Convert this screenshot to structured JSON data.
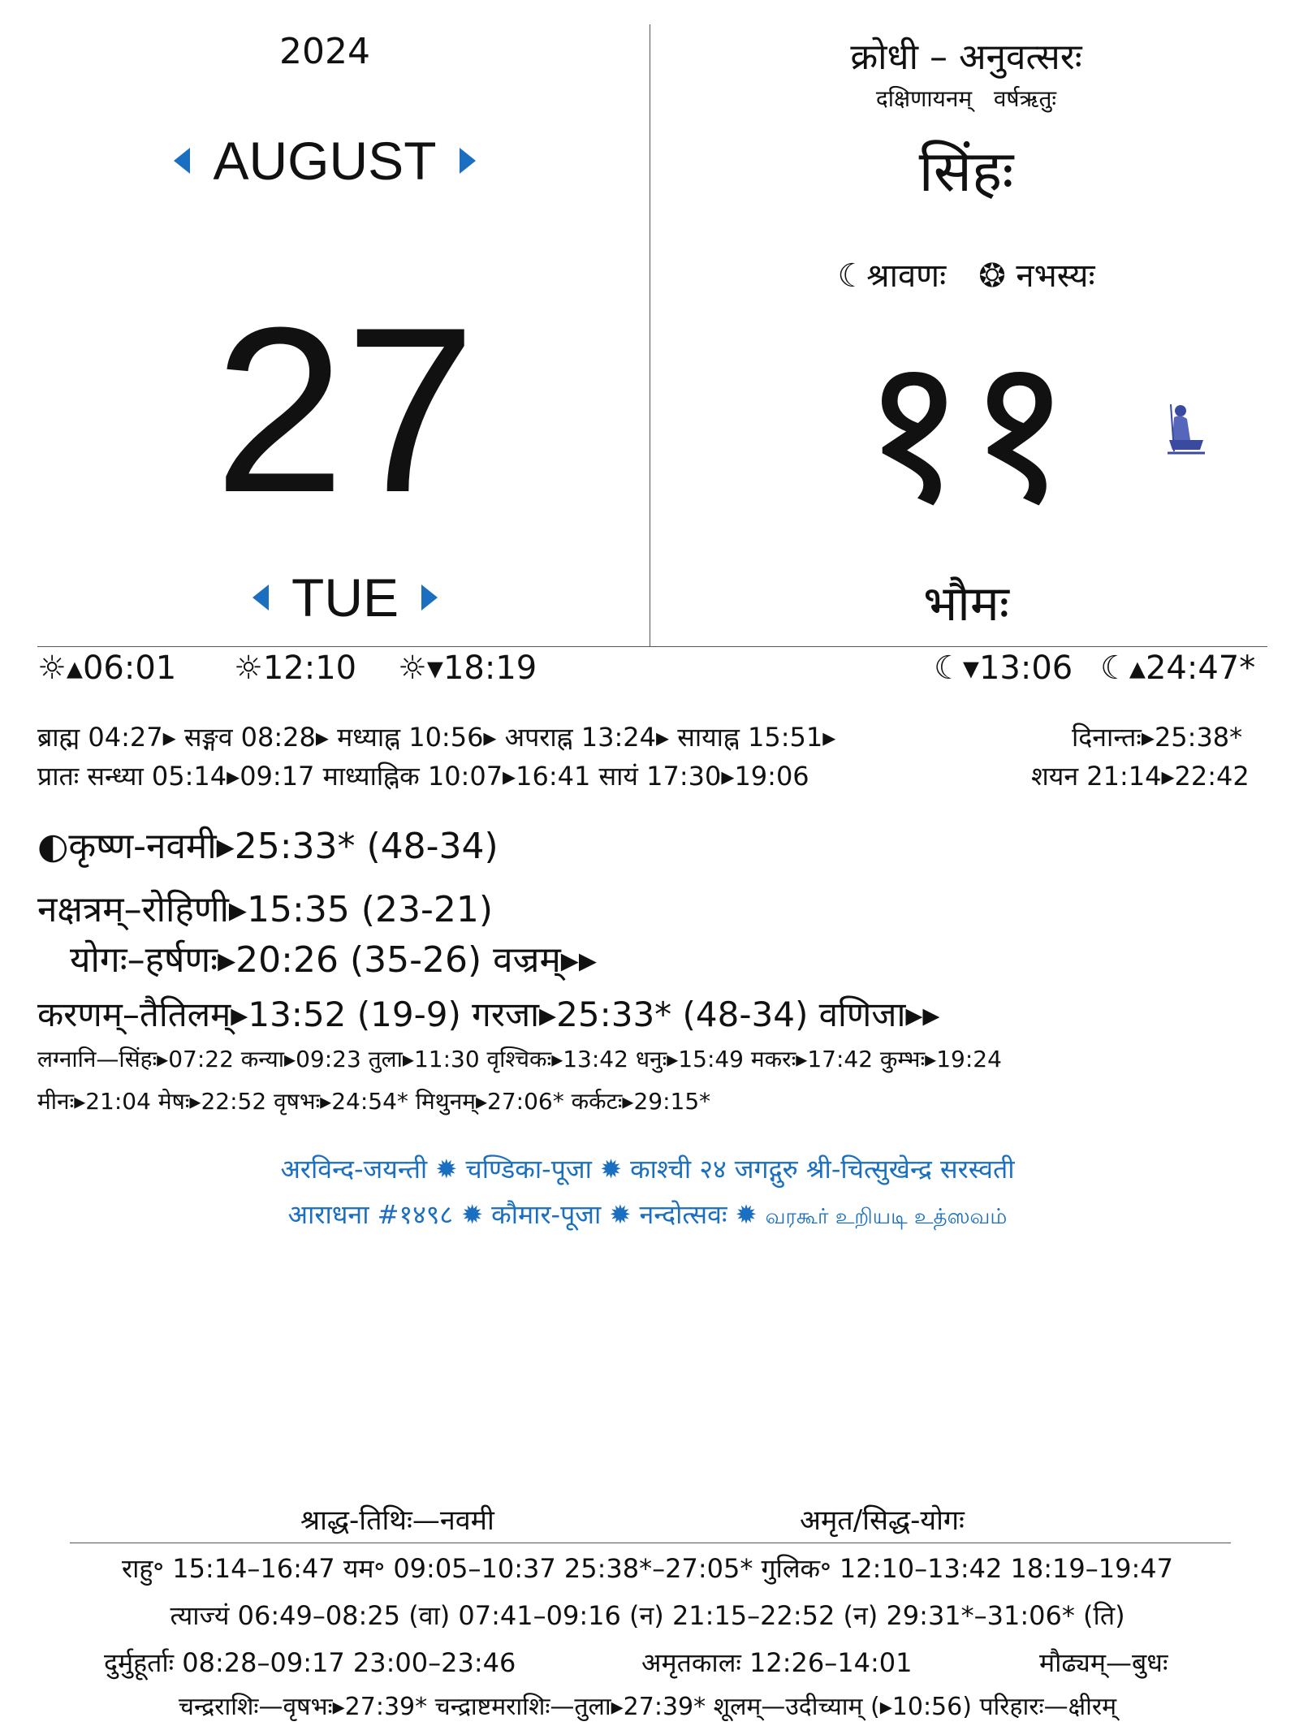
{
  "header": {
    "year": "2024",
    "month": "AUGUST",
    "day_number": "27",
    "weekday": "TUE",
    "samvatsara": "क्रोधी – अनुवत्सरः",
    "ayana_ritu": "दक्षिणायनम्   वर्षऋतुः",
    "rashi_month": "सिंहः",
    "lunar_month": "☾श्रावणः",
    "solar_month": "❂ नभस्यः",
    "tithi_number": "११",
    "vara": "भौमः"
  },
  "sun_moon": {
    "sunrise": "☼▴06:01",
    "noon": "☼12:10",
    "sunset": "☼▾18:19",
    "moonset": "☾▾13:06",
    "moonrise": "☾▴24:47*"
  },
  "kala": {
    "line1": "ब्राह्म 04:27▸ सङ्गव 08:28▸ मध्याह्न 10:56▸ अपराह्न 13:24▸ सायाह्न 15:51▸",
    "dinanta": "दिनान्तः▸25:38*",
    "line2": "प्रातः सन्ध्या 05:14▸09:17 माध्याह्निक 10:07▸16:41 सायं 17:30▸19:06",
    "shayana": "शयन 21:14▸22:42"
  },
  "panchanga": {
    "tithi": "◐कृष्ण-नवमी▸25:33* (48-34)",
    "nakshatra": "नक्षत्रम्–रोहिणी▸15:35 (23-21)",
    "yoga": "योगः–हर्षणः▸20:26 (35-26)  वज्रम्▸▸",
    "karana": "करणम्–तैतिलम्▸13:52 (19-9)  गरजा▸25:33* (48-34)  वणिजा▸▸",
    "lagna1": "लग्नानि—सिंहः▸07:22   कन्या▸09:23   तुला▸11:30   वृश्चिकः▸13:42   धनुः▸15:49   मकरः▸17:42   कुम्भः▸19:24",
    "lagna2": "मीनः▸21:04  मेषः▸22:52  वृषभः▸24:54*  मिथुनम्▸27:06*  कर्कटः▸29:15*"
  },
  "festivals": {
    "line1": "अरविन्द-जयन्ती ✹ चण्डिका-पूजा ✹ काश्ची २४ जगद्गुरु श्री-चित्सुखेन्द्र सरस्वती",
    "line2a": "आराधना #१४९८ ✹ कौमार-पूजा ✹ नन्दोत्सवः ✹ ",
    "line2b": "வரகூர் உறியடி உத்ஸவம்"
  },
  "footer": {
    "shraddha": "श्राद्ध-तिथिः—नवमी",
    "amrita": "अमृत/सिद्ध-योगः",
    "line1": "राहु॰ 15:14–16:47   यम॰ 09:05–10:37  25:38*–27:05*   गुलिक॰ 12:10–13:42  18:19–19:47",
    "line2": "त्याज्यं 06:49–08:25 (वा) 07:41–09:16 (न) 21:15–22:52 (न) 29:31*–31:06* (ति)",
    "line3a": "दुर्मुहूर्ताः 08:28–09:17    23:00–23:46",
    "line3b": "अमृतकालः 12:26–14:01",
    "line3c": "मौढ्यम्—बुधः",
    "line4": "चन्द्रराशिः—वृषभः▸27:39*  चन्द्राष्टमराशिः—तुला▸27:39*  शूलम्—उदीच्याम् (▸10:56) परिहारः—क्षीरम्"
  }
}
